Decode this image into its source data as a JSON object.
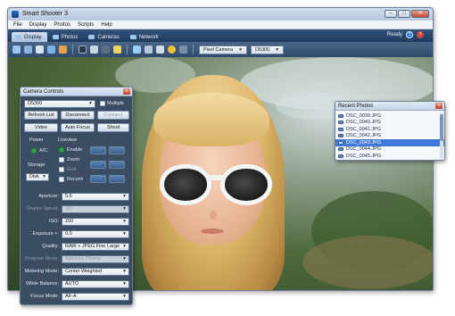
{
  "window": {
    "title": "Smart Shooter 3",
    "minimize": "–",
    "maximize": "□",
    "close": "✕"
  },
  "menu": [
    "File",
    "Display",
    "Photos",
    "Scripts",
    "Help"
  ],
  "tabs": [
    {
      "label": "Display",
      "active": true
    },
    {
      "label": "Photos",
      "active": false
    },
    {
      "label": "Cameras",
      "active": false
    },
    {
      "label": "Network",
      "active": false
    }
  ],
  "status": {
    "text": "Ready",
    "badge": "1",
    "help": "?"
  },
  "toolbar": {
    "camera_select": "Pixel Camera",
    "model_select": "D5300"
  },
  "camera_controls": {
    "title": "Camera Controls",
    "close": "x",
    "camera": "D5300",
    "multiple_label": "Multiple",
    "buttons": {
      "refresh": "Refresh List",
      "disconnect": "Disconnect",
      "connect": "Connect",
      "video": "Video",
      "autofocus": "Auto Focus",
      "shoot": "Shoot"
    },
    "power_label": "Power",
    "ac_label": "A/C",
    "storage_label": "Storage",
    "storage_value": "Disk",
    "liveview_label": "Liveview",
    "enable_label": "Enable",
    "zoom_label": "Zoom",
    "grid_label": "Grid",
    "record_label": "Record",
    "settings": [
      {
        "label": "Aperture:",
        "value": "5.6",
        "disabled": false
      },
      {
        "label": "Shutter Speed:",
        "value": "1/0",
        "disabled": true
      },
      {
        "label": "ISO:",
        "value": "200",
        "disabled": false
      },
      {
        "label": "Exposure +:",
        "value": "0.0",
        "disabled": false
      },
      {
        "label": "Quality:",
        "value": "RAW + JPEG Fine Large",
        "disabled": false
      },
      {
        "label": "Program Mode:",
        "value": "Aperture Priority",
        "disabled": true
      },
      {
        "label": "Metering Mode:",
        "value": "Center Weighted",
        "disabled": false
      },
      {
        "label": "White Balance:",
        "value": "AUTO",
        "disabled": false
      },
      {
        "label": "Focus Mode:",
        "value": "AF-A",
        "disabled": false
      }
    ]
  },
  "recent_photos": {
    "title": "Recent Photos",
    "close": "x",
    "items": [
      {
        "name": "DSC_0039.JPG",
        "selected": false
      },
      {
        "name": "DSC_0040.JPG",
        "selected": false
      },
      {
        "name": "DSC_0041.JPG",
        "selected": false
      },
      {
        "name": "DSC_0042.JPG",
        "selected": false
      },
      {
        "name": "DSC_0043.JPG",
        "selected": true
      },
      {
        "name": "DSC_0044.JPG",
        "selected": false
      },
      {
        "name": "DSC_0045.JPG",
        "selected": false
      }
    ]
  },
  "colors": {
    "accent": "#3f7ad8",
    "panel_dark": "#3b4d63",
    "tab_bar": "#203a5d",
    "enabled_check": "#2ea84a"
  }
}
